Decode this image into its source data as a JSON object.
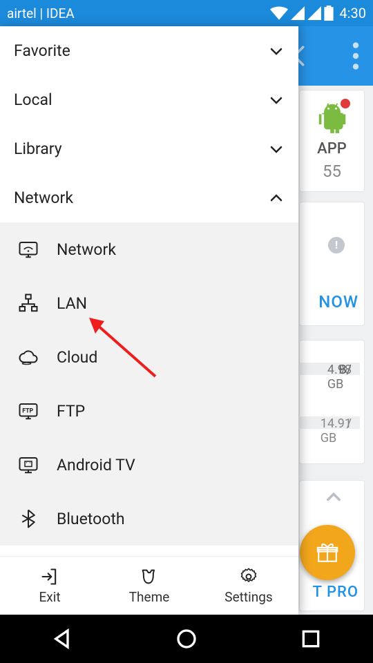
{
  "statusbar": {
    "carrier": "airtel | IDEA",
    "time": "4:30"
  },
  "background": {
    "app_card": {
      "label": "APP",
      "count": "55"
    },
    "now_card": {
      "action": "NOW"
    },
    "storage": {
      "line1_used": "B/",
      "line1_total": "4.98 GB",
      "line2_sep": "/",
      "line2_total": "14.91 GB"
    },
    "pro_card": {
      "label": "T PRO"
    }
  },
  "drawer": {
    "sections": {
      "favorite": "Favorite",
      "local": "Local",
      "library": "Library",
      "network": "Network"
    },
    "network_items": {
      "network": "Network",
      "lan": "LAN",
      "cloud": "Cloud",
      "ftp": "FTP",
      "androidtv": "Android TV",
      "bluetooth": "Bluetooth"
    },
    "bottom": {
      "exit": "Exit",
      "theme": "Theme",
      "settings": "Settings"
    }
  }
}
